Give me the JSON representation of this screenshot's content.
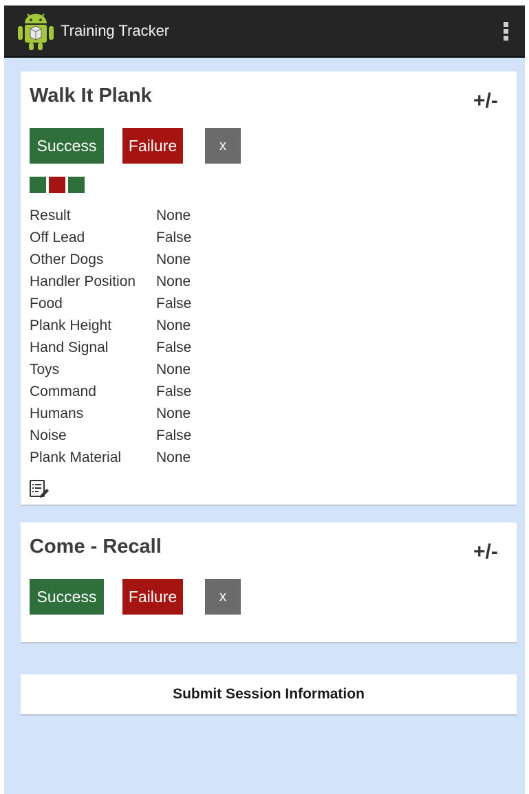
{
  "app": {
    "title": "Training Tracker",
    "icon": "android-app-icon",
    "menu_icon": "overflow-menu-icon"
  },
  "colors": {
    "action_bar": "#252525",
    "background": "#d3e3fa",
    "success": "#2f6f3b",
    "failure": "#a51410",
    "clear": "#6b6b6b"
  },
  "cards": [
    {
      "title": "Walk It Plank",
      "toggle_label": "+/-",
      "buttons": {
        "success": "Success",
        "failure": "Failure",
        "clear": "x"
      },
      "history": [
        "success",
        "failure",
        "success"
      ],
      "attributes": [
        {
          "label": "Result",
          "value": "None"
        },
        {
          "label": "Off Lead",
          "value": "False"
        },
        {
          "label": "Other Dogs",
          "value": "None"
        },
        {
          "label": "Handler Position",
          "value": "None"
        },
        {
          "label": "Food",
          "value": "False"
        },
        {
          "label": "Plank Height",
          "value": "None"
        },
        {
          "label": "Hand Signal",
          "value": "False"
        },
        {
          "label": "Toys",
          "value": "None"
        },
        {
          "label": "Command",
          "value": "False"
        },
        {
          "label": "Humans",
          "value": "None"
        },
        {
          "label": "Noise",
          "value": "False"
        },
        {
          "label": "Plank Material",
          "value": "None"
        }
      ],
      "edit_icon": "edit-notes-icon"
    },
    {
      "title": "Come - Recall",
      "toggle_label": "+/-",
      "buttons": {
        "success": "Success",
        "failure": "Failure",
        "clear": "x"
      }
    }
  ],
  "submit_label": "Submit Session Information"
}
